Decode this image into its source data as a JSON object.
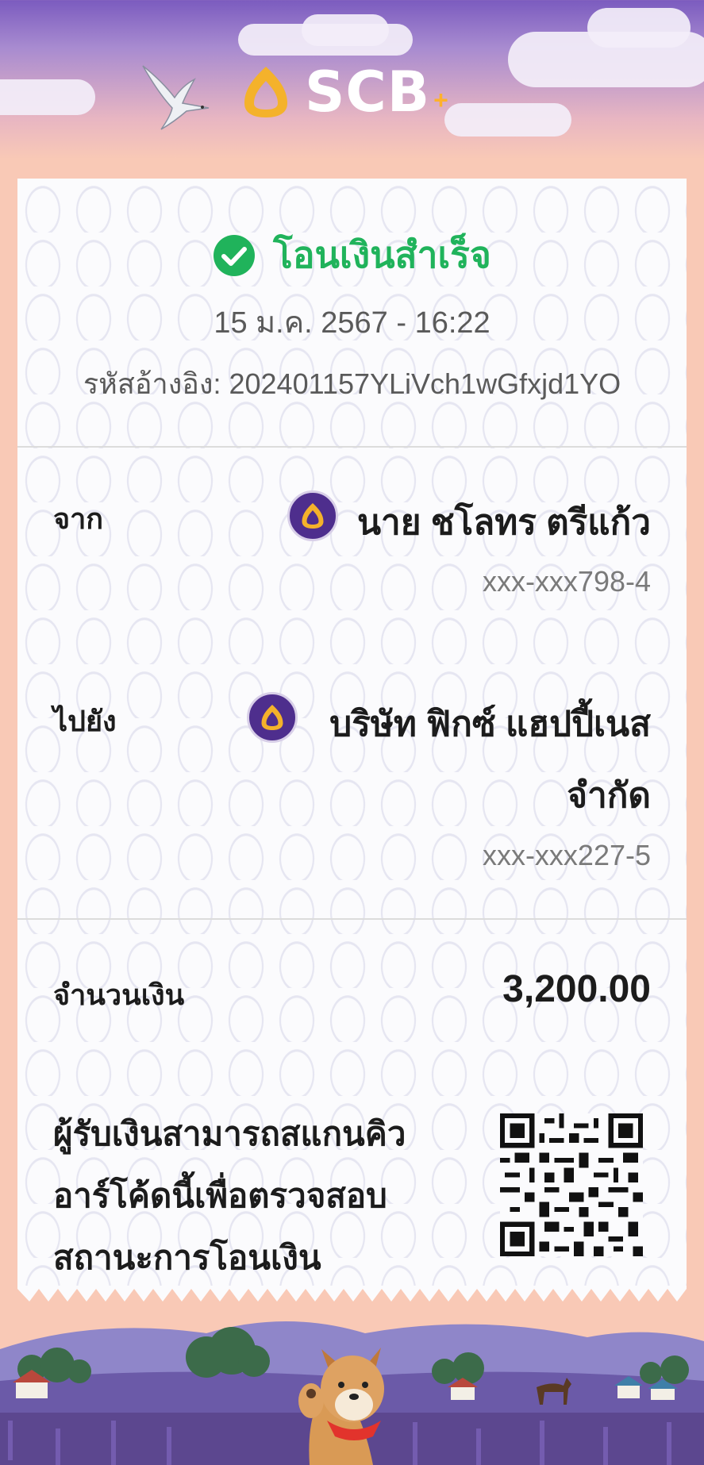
{
  "header": {
    "logo_text": "SCB",
    "logo_plus": "+",
    "brand_colors": {
      "purple": "#4e2e8d",
      "gold": "#f4b22b"
    }
  },
  "receipt": {
    "status": "โอนเงินสำเร็จ",
    "status_icon": "check-circle-icon",
    "status_color": "#20b35b",
    "datetime": "15 ม.ค. 2567 - 16:22",
    "reference": "รหัสอ้างอิง: 202401157YLiVch1wGfxjd1YO",
    "from": {
      "label": "จาก",
      "name": "นาย ชโลทร ตรีแก้ว",
      "account": "xxx-xxx798-4",
      "bank_icon": "scb-bank-icon"
    },
    "to": {
      "label": "ไปยัง",
      "name_line1": "บริษัท ฟิกซ์ แฮปปี้เนส",
      "name_line2": "จำกัด",
      "account": "xxx-xxx227-5",
      "bank_icon": "scb-bank-icon"
    },
    "amount": {
      "label": "จำนวนเงิน",
      "value": "3,200.00"
    },
    "qr_note": {
      "line1": "ผู้รับเงินสามารถสแกนคิว",
      "line2": "อาร์โค้ดนี้เพื่อตรวจสอบ",
      "line3": "สถานะการโอนเงิน"
    }
  }
}
